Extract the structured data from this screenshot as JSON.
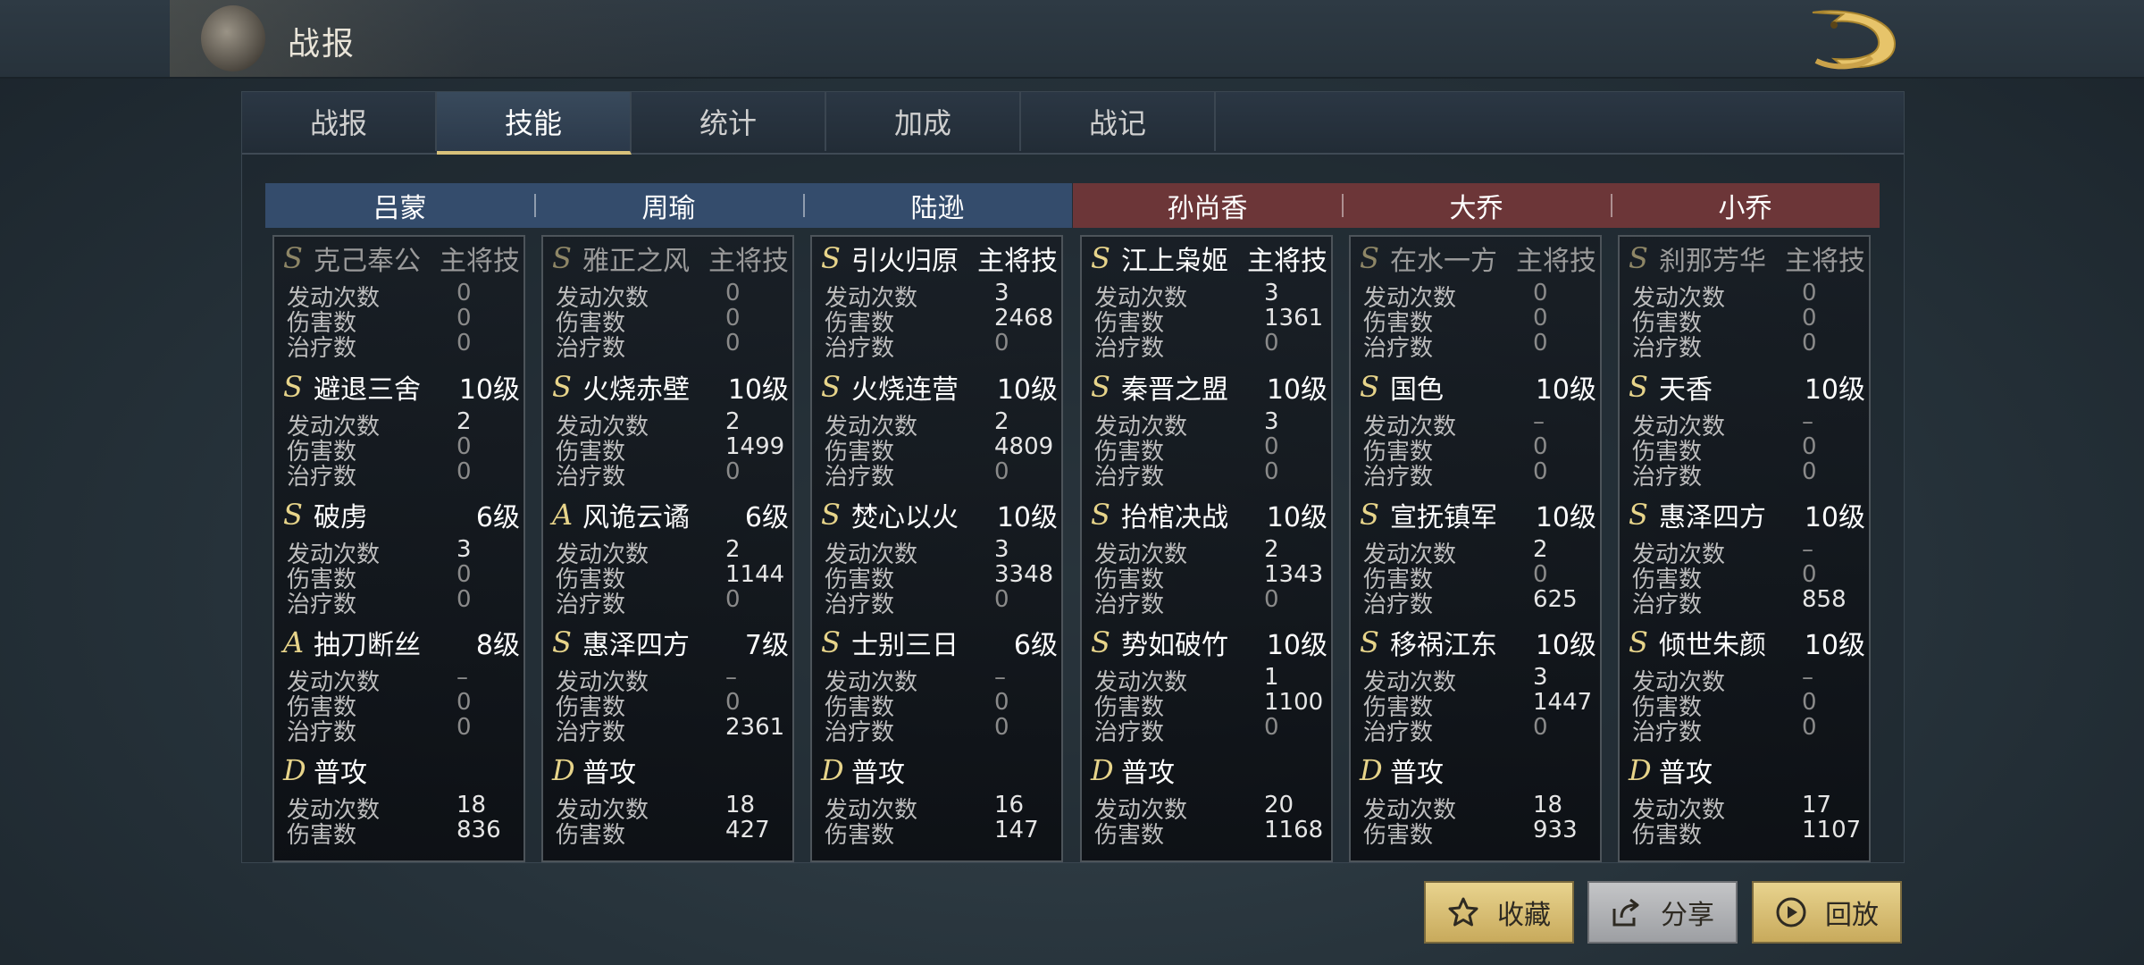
{
  "header": {
    "title": "战报"
  },
  "tabs": [
    {
      "label": "战报",
      "active": false
    },
    {
      "label": "技能",
      "active": true
    },
    {
      "label": "统计",
      "active": false
    },
    {
      "label": "加成",
      "active": false
    },
    {
      "label": "战记",
      "active": false
    }
  ],
  "generals": [
    {
      "name": "吕蒙",
      "team": "blue",
      "skills": [
        {
          "grade": "S",
          "name": "克己奉公",
          "level": "主将技",
          "dim": true,
          "stats": [
            [
              "发动次数",
              "0"
            ],
            [
              "伤害数",
              "0"
            ],
            [
              "治疗数",
              "0"
            ]
          ]
        },
        {
          "grade": "S",
          "name": "避退三舍",
          "level": "10级",
          "stats": [
            [
              "发动次数",
              "2"
            ],
            [
              "伤害数",
              "0"
            ],
            [
              "治疗数",
              "0"
            ]
          ]
        },
        {
          "grade": "S",
          "name": "破虏",
          "level": "6级",
          "stats": [
            [
              "发动次数",
              "3"
            ],
            [
              "伤害数",
              "0"
            ],
            [
              "治疗数",
              "0"
            ]
          ]
        },
        {
          "grade": "A",
          "name": "抽刀断丝",
          "level": "8级",
          "stats": [
            [
              "发动次数",
              "–"
            ],
            [
              "伤害数",
              "0"
            ],
            [
              "治疗数",
              "0"
            ]
          ]
        },
        {
          "grade": "D",
          "name": "普攻",
          "level": "",
          "stats": [
            [
              "发动次数",
              "18"
            ],
            [
              "伤害数",
              "836"
            ]
          ]
        }
      ]
    },
    {
      "name": "周瑜",
      "team": "blue",
      "skills": [
        {
          "grade": "S",
          "name": "雅正之风",
          "level": "主将技",
          "dim": true,
          "stats": [
            [
              "发动次数",
              "0"
            ],
            [
              "伤害数",
              "0"
            ],
            [
              "治疗数",
              "0"
            ]
          ]
        },
        {
          "grade": "S",
          "name": "火烧赤壁",
          "level": "10级",
          "stats": [
            [
              "发动次数",
              "2"
            ],
            [
              "伤害数",
              "1499"
            ],
            [
              "治疗数",
              "0"
            ]
          ]
        },
        {
          "grade": "A",
          "name": "风诡云谲",
          "level": "6级",
          "stats": [
            [
              "发动次数",
              "2"
            ],
            [
              "伤害数",
              "1144"
            ],
            [
              "治疗数",
              "0"
            ]
          ]
        },
        {
          "grade": "S",
          "name": "惠泽四方",
          "level": "7级",
          "stats": [
            [
              "发动次数",
              "–"
            ],
            [
              "伤害数",
              "0"
            ],
            [
              "治疗数",
              "2361"
            ]
          ]
        },
        {
          "grade": "D",
          "name": "普攻",
          "level": "",
          "stats": [
            [
              "发动次数",
              "18"
            ],
            [
              "伤害数",
              "427"
            ]
          ]
        }
      ]
    },
    {
      "name": "陆逊",
      "team": "blue",
      "skills": [
        {
          "grade": "S",
          "name": "引火归原",
          "level": "主将技",
          "stats": [
            [
              "发动次数",
              "3"
            ],
            [
              "伤害数",
              "2468"
            ],
            [
              "治疗数",
              "0"
            ]
          ]
        },
        {
          "grade": "S",
          "name": "火烧连营",
          "level": "10级",
          "stats": [
            [
              "发动次数",
              "2"
            ],
            [
              "伤害数",
              "4809"
            ],
            [
              "治疗数",
              "0"
            ]
          ]
        },
        {
          "grade": "S",
          "name": "焚心以火",
          "level": "10级",
          "stats": [
            [
              "发动次数",
              "3"
            ],
            [
              "伤害数",
              "3348"
            ],
            [
              "治疗数",
              "0"
            ]
          ]
        },
        {
          "grade": "S",
          "name": "士别三日",
          "level": "6级",
          "stats": [
            [
              "发动次数",
              "–"
            ],
            [
              "伤害数",
              "0"
            ],
            [
              "治疗数",
              "0"
            ]
          ]
        },
        {
          "grade": "D",
          "name": "普攻",
          "level": "",
          "stats": [
            [
              "发动次数",
              "16"
            ],
            [
              "伤害数",
              "147"
            ]
          ]
        }
      ]
    },
    {
      "name": "孙尚香",
      "team": "red",
      "skills": [
        {
          "grade": "S",
          "name": "江上枭姬",
          "level": "主将技",
          "stats": [
            [
              "发动次数",
              "3"
            ],
            [
              "伤害数",
              "1361"
            ],
            [
              "治疗数",
              "0"
            ]
          ]
        },
        {
          "grade": "S",
          "name": "秦晋之盟",
          "level": "10级",
          "stats": [
            [
              "发动次数",
              "3"
            ],
            [
              "伤害数",
              "0"
            ],
            [
              "治疗数",
              "0"
            ]
          ]
        },
        {
          "grade": "S",
          "name": "抬棺决战",
          "level": "10级",
          "stats": [
            [
              "发动次数",
              "2"
            ],
            [
              "伤害数",
              "1343"
            ],
            [
              "治疗数",
              "0"
            ]
          ]
        },
        {
          "grade": "S",
          "name": "势如破竹",
          "level": "10级",
          "stats": [
            [
              "发动次数",
              "1"
            ],
            [
              "伤害数",
              "1100"
            ],
            [
              "治疗数",
              "0"
            ]
          ]
        },
        {
          "grade": "D",
          "name": "普攻",
          "level": "",
          "stats": [
            [
              "发动次数",
              "20"
            ],
            [
              "伤害数",
              "1168"
            ]
          ]
        }
      ]
    },
    {
      "name": "大乔",
      "team": "red",
      "skills": [
        {
          "grade": "S",
          "name": "在水一方",
          "level": "主将技",
          "dim": true,
          "stats": [
            [
              "发动次数",
              "0"
            ],
            [
              "伤害数",
              "0"
            ],
            [
              "治疗数",
              "0"
            ]
          ]
        },
        {
          "grade": "S",
          "name": "国色",
          "level": "10级",
          "stats": [
            [
              "发动次数",
              "–"
            ],
            [
              "伤害数",
              "0"
            ],
            [
              "治疗数",
              "0"
            ]
          ]
        },
        {
          "grade": "S",
          "name": "宣抚镇军",
          "level": "10级",
          "stats": [
            [
              "发动次数",
              "2"
            ],
            [
              "伤害数",
              "0"
            ],
            [
              "治疗数",
              "625"
            ]
          ]
        },
        {
          "grade": "S",
          "name": "移祸江东",
          "level": "10级",
          "stats": [
            [
              "发动次数",
              "3"
            ],
            [
              "伤害数",
              "1447"
            ],
            [
              "治疗数",
              "0"
            ]
          ]
        },
        {
          "grade": "D",
          "name": "普攻",
          "level": "",
          "stats": [
            [
              "发动次数",
              "18"
            ],
            [
              "伤害数",
              "933"
            ]
          ]
        }
      ]
    },
    {
      "name": "小乔",
      "team": "red",
      "skills": [
        {
          "grade": "S",
          "name": "刹那芳华",
          "level": "主将技",
          "dim": true,
          "stats": [
            [
              "发动次数",
              "0"
            ],
            [
              "伤害数",
              "0"
            ],
            [
              "治疗数",
              "0"
            ]
          ]
        },
        {
          "grade": "S",
          "name": "天香",
          "level": "10级",
          "stats": [
            [
              "发动次数",
              "–"
            ],
            [
              "伤害数",
              "0"
            ],
            [
              "治疗数",
              "0"
            ]
          ]
        },
        {
          "grade": "S",
          "name": "惠泽四方",
          "level": "10级",
          "stats": [
            [
              "发动次数",
              "–"
            ],
            [
              "伤害数",
              "0"
            ],
            [
              "治疗数",
              "858"
            ]
          ]
        },
        {
          "grade": "S",
          "name": "倾世朱颜",
          "level": "10级",
          "stats": [
            [
              "发动次数",
              "–"
            ],
            [
              "伤害数",
              "0"
            ],
            [
              "治疗数",
              "0"
            ]
          ]
        },
        {
          "grade": "D",
          "name": "普攻",
          "level": "",
          "stats": [
            [
              "发动次数",
              "17"
            ],
            [
              "伤害数",
              "1107"
            ]
          ]
        }
      ]
    }
  ],
  "buttons": [
    {
      "label": "收藏",
      "icon": "star-icon",
      "style": "gold"
    },
    {
      "label": "分享",
      "icon": "share-icon",
      "style": "gray"
    },
    {
      "label": "回放",
      "icon": "play-icon",
      "style": "gold"
    }
  ],
  "colors": {
    "blue_team": "#344c6c",
    "red_team": "#6c3638",
    "accent": "#d8c17a"
  }
}
